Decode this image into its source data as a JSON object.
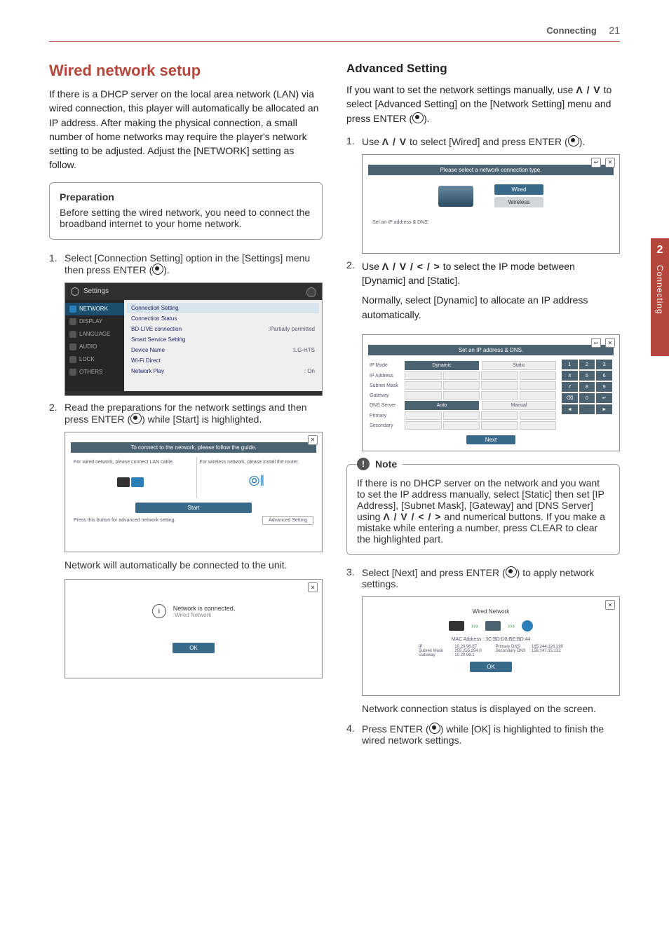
{
  "header": {
    "section": "Connecting",
    "page": "21"
  },
  "sideTab": {
    "num": "2",
    "label": "Connecting"
  },
  "left": {
    "title": "Wired network setup",
    "intro": "If there is a DHCP server on the local area network (LAN) via wired connection, this player will automatically be allocated an IP address. After making the physical connection, a small number of home networks may require the player's network setting to be adjusted. Adjust the [NETWORK] setting as follow.",
    "prepTitle": "Preparation",
    "prepBody": "Before setting the wired network, you need to connect the broadband internet to your home network.",
    "step1num": "1.",
    "step1": "Select [Connection Setting] option in the [Settings] menu then press ENTER (",
    "step1end": ").",
    "step2num": "2.",
    "step2a": "Read the preparations for the network settings and then press ENTER (",
    "step2b": ") while [Start] is highlighted.",
    "step2foot": "Network will automatically be connected to the unit."
  },
  "shotSettings": {
    "title": "Settings",
    "side": [
      "NETWORK",
      "DISPLAY",
      "LANGUAGE",
      "AUDIO",
      "LOCK",
      "OTHERS"
    ],
    "rows": [
      {
        "lbl": "Connection Setting",
        "val": ""
      },
      {
        "lbl": "Connection Status",
        "val": ""
      },
      {
        "lbl": "BD-LIVE connection",
        "val": ":Partially permitted"
      },
      {
        "lbl": "Smart Service Setting",
        "val": ""
      },
      {
        "lbl": "Device Name",
        "val": ":LG-HTS"
      },
      {
        "lbl": "Wi-Fi Direct",
        "val": ""
      },
      {
        "lbl": "Network Play",
        "val": ": On"
      }
    ]
  },
  "shotGuide": {
    "title": "To connect to the network, please follow the guide.",
    "leftText": "For wired network, please connect LAN cable.",
    "rightText": "For wireless network, please install the router.",
    "start": "Start",
    "footText": "Press this button for advanced network setting.",
    "adv": "Advanced Setting"
  },
  "shotConn": {
    "line1": "Network is connected,",
    "line2": ":Wired Network",
    "ok": "OK"
  },
  "right": {
    "title": "Advanced Setting",
    "intro1": "If you want to set the network settings manually, use ",
    "intro2": " to select [Advanced Setting] on the [Network Setting] menu and press ENTER (",
    "intro3": ").",
    "s1num": "1.",
    "s1a": "Use ",
    "s1b": " to select [Wired] and press ENTER (",
    "s1c": ").",
    "s2num": "2.",
    "s2a": "Use ",
    "s2b": " to select the IP mode between [Dynamic] and [Static].",
    "s2c": "Normally, select [Dynamic] to allocate an IP address automatically.",
    "noteTitle": "Note",
    "noteA": "If there is no DHCP server on the network and you want to set the IP address manually, select [Static] then set [IP Address], [Subnet Mask], [Gateway] and [DNS Server] using ",
    "noteB": " and numerical buttons. If you make a mistake while entering a number, press CLEAR to clear the highlighted part.",
    "s3num": "3.",
    "s3a": "Select [Next] and press ENTER (",
    "s3b": ") to apply network settings.",
    "s3foot": "Network connection status is displayed on the screen.",
    "s4num": "4.",
    "s4a": "Press ENTER (",
    "s4b": ") while [OK] is highlighted to finish the wired network settings."
  },
  "shotType": {
    "title": "Please select a network connection type.",
    "wired": "Wired",
    "wireless": "Wireless",
    "foot": "Set an IP address & DNS."
  },
  "shotIP": {
    "title": "Set an IP address & DNS.",
    "ipmode": "IP Mode",
    "dyn": "Dynamic",
    "stat": "Static",
    "ipaddr": "IP Address",
    "subnet": "Subnet Mask",
    "gw": "Gateway",
    "dns": "DNS Server",
    "auto": "Auto",
    "manual": "Manual",
    "prim": "Primary",
    "sec": "Secondary",
    "next": "Next",
    "keys": [
      [
        "1",
        "2",
        "3"
      ],
      [
        "4",
        "5",
        "6"
      ],
      [
        "7",
        "8",
        "9"
      ],
      [
        "⌫",
        "0",
        "↵"
      ],
      [
        "◄",
        "",
        "►"
      ]
    ]
  },
  "shotStat": {
    "title": "Wired Network",
    "mac": "MAC Address : 3C:BD:D8:BE:BD:44",
    "left": [
      [
        "IP",
        ": 10.20.96.87"
      ],
      [
        "Subnet Mask",
        ": 255.255.254.0"
      ],
      [
        "Gateway",
        ": 10.20.96.1"
      ]
    ],
    "right": [
      [
        "Primary DNS",
        ": 165.244.126.190"
      ],
      [
        "Secondary DNS",
        ": 156.147.15.132"
      ]
    ],
    "ok": "OK"
  },
  "glyphs": {
    "ud": "Ʌ / V",
    "udlr": "Ʌ / V / < / >",
    "udlr_note": "Ʌ / V / < / >"
  }
}
